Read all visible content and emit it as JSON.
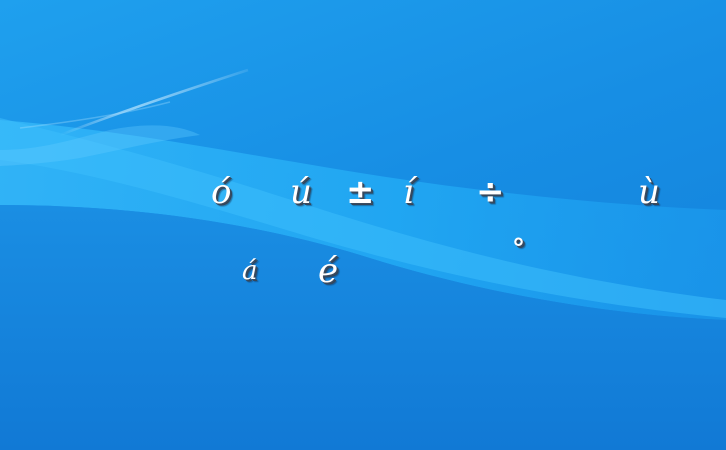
{
  "desktop": {
    "colors": {
      "background_top": "#1fa0ee",
      "background_bottom": "#127ed8",
      "ribbon": "#29b0f6",
      "streak": "#8fd6ff"
    },
    "glyphs": [
      {
        "id": "o_acute",
        "char": "ó"
      },
      {
        "id": "u_acute",
        "char": "ú"
      },
      {
        "id": "plus_minus",
        "char": "±"
      },
      {
        "id": "i_acute",
        "char": "í"
      },
      {
        "id": "division",
        "char": "÷"
      },
      {
        "id": "u_grave",
        "char": "ù"
      },
      {
        "id": "a_acute",
        "char": "á"
      },
      {
        "id": "e_acute",
        "char": "é"
      },
      {
        "id": "degree",
        "char": "°"
      }
    ]
  }
}
